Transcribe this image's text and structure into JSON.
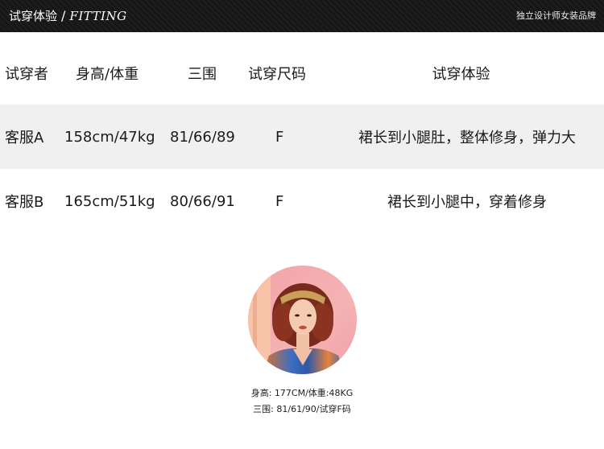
{
  "header": {
    "title_cn": "试穿体验",
    "separator": "/",
    "title_en": "FITTING",
    "brand": "独立设计师女装品牌"
  },
  "table": {
    "columns": [
      "试穿者",
      "身高/体重",
      "三围",
      "试穿尺码",
      "试穿体验"
    ],
    "rows": [
      {
        "name": "客服A",
        "height_weight": "158cm/47kg",
        "measurements": "81/66/89",
        "size": "F",
        "experience": "裙长到小腿肚，整体修身，弹力大"
      },
      {
        "name": "客服B",
        "height_weight": "165cm/51kg",
        "measurements": "80/66/91",
        "size": "F",
        "experience": "裙长到小腿中，穿着修身"
      }
    ]
  },
  "model": {
    "line1": "身高: 177CM/体重:48KG",
    "line2": "三围: 81/61/90/试穿F码"
  },
  "colors": {
    "header_bg": "#161616",
    "row_alt_bg": "#f0f0f0",
    "text": "#1a1a1a"
  }
}
